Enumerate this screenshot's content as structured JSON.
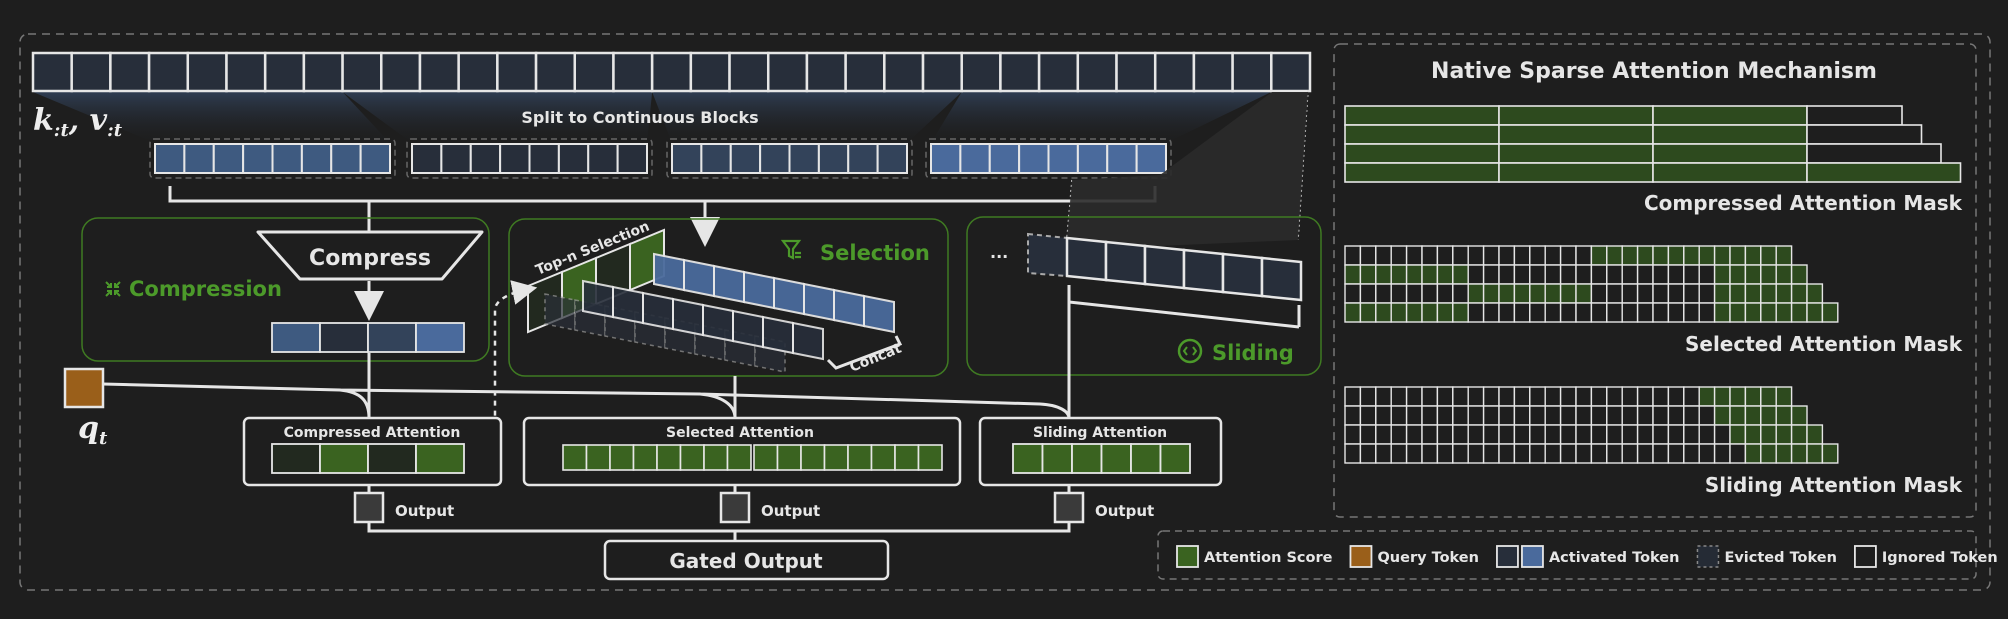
{
  "title": "Native Sparse Attention Mechanism",
  "colors": {
    "background": "#1e1e1e",
    "attention_score": "#3a6320",
    "attention_score_dark": "#22291f",
    "mask_green": "#2d4a1e",
    "query": "#9a5f1a",
    "token_dark": "#272e3a",
    "token_blue": "#4a6a9c",
    "block_colors": [
      "#3e5a80",
      "#272e3a",
      "#33435a",
      "#4a6a9c"
    ],
    "accent_green": "#4c9a2a",
    "line": "#e6e6e6",
    "output": "#3a3a3a"
  },
  "input": {
    "kv_label": "k:t, v:t",
    "token_count": 33,
    "split_label": "Split to Continuous Blocks",
    "blocks": [
      {
        "tokens": 8,
        "color_index": 0
      },
      {
        "tokens": 8,
        "color_index": 1
      },
      {
        "tokens": 8,
        "color_index": 2
      },
      {
        "tokens": 8,
        "color_index": 3
      }
    ]
  },
  "branches": {
    "compression": {
      "label": "Compression",
      "icon": "compress-arrows-icon",
      "op_label": "Compress",
      "compressed_tokens": [
        0,
        1,
        2,
        3
      ]
    },
    "selection": {
      "label": "Selection",
      "icon": "filter-funnel-icon",
      "topn_label": "Top-n Selection",
      "concat_label": "Concat"
    },
    "sliding": {
      "label": "Sliding",
      "icon": "sliding-circle-icon",
      "ellipsis": "...",
      "window_tokens": 6
    }
  },
  "query": {
    "label": "q_t",
    "symbol": "q",
    "subscript": "t"
  },
  "attention": {
    "compressed": {
      "label": "Compressed Attention",
      "scores": [
        0,
        1,
        0,
        1
      ]
    },
    "selected": {
      "label": "Selected Attention",
      "cells": 16
    },
    "sliding": {
      "label": "Sliding Attention",
      "cells": 6
    }
  },
  "outputs": {
    "label": "Output",
    "gated_label": "Gated Output"
  },
  "masks": {
    "compressed": {
      "label": "Compressed Attention Mask",
      "rows": [
        [
          1,
          1,
          1,
          0
        ],
        [
          1,
          1,
          1,
          0
        ],
        [
          1,
          1,
          1,
          0
        ],
        [
          1,
          1,
          1,
          1
        ]
      ],
      "row_extra": [
        0,
        1,
        2,
        3
      ]
    },
    "selected": {
      "label": "Selected Attention Mask",
      "rows": [
        "00000000000000001111111111111",
        "111111110000000000000000111111",
        "0000000011111111000000001111111",
        "11111111000000000000000011111111"
      ]
    },
    "sliding": {
      "label": "Sliding Attention Mask",
      "rows": [
        "00000000000000000000000111111",
        "000000000000000000000000111111",
        "0000000000000000000000000111111",
        "00000000000000000000000000111111"
      ]
    }
  },
  "legend": [
    {
      "label": "Attention Score",
      "swatch": "attention"
    },
    {
      "label": "Query Token",
      "swatch": "query"
    },
    {
      "label": "Activated Token",
      "swatch": "activated"
    },
    {
      "label": "Evicted Token",
      "swatch": "evicted"
    },
    {
      "label": "Ignored Token",
      "swatch": "ignored"
    }
  ]
}
